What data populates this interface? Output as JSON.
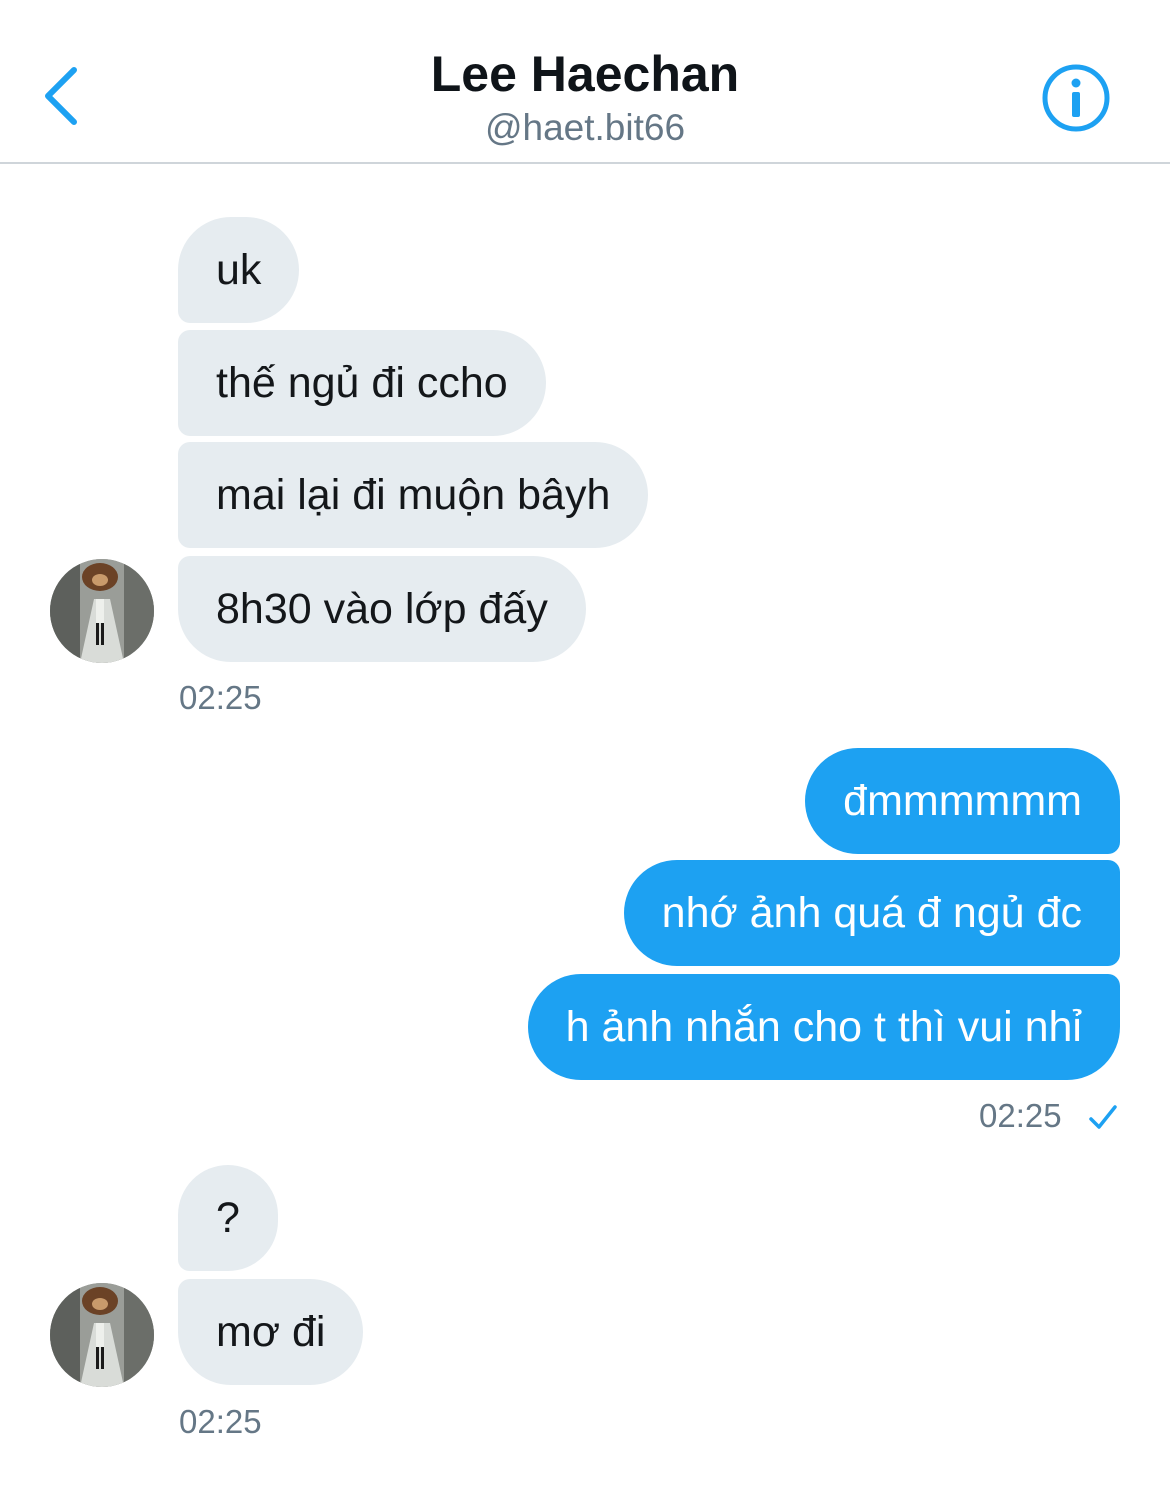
{
  "header": {
    "title": "Lee Haechan",
    "handle": "@haet.bit66"
  },
  "messages": [
    {
      "text": "uk"
    },
    {
      "text": "thế ngủ đi ccho"
    },
    {
      "text": "mai lại đi muộn bâyh"
    },
    {
      "text": "8h30 vào lớp đấy"
    },
    {
      "time": "02:25"
    },
    {
      "text": "đmmmmmm"
    },
    {
      "text": "nhớ ảnh quá đ ngủ đc"
    },
    {
      "text": "h ảnh nhắn cho t thì vui nhỉ"
    },
    {
      "time": "02:25"
    },
    {
      "text": "?"
    },
    {
      "text": "mơ đi"
    },
    {
      "time": "02:25"
    }
  ],
  "colors": {
    "accent": "#1da1f2",
    "incoming_bubble": "#e6ecf0",
    "secondary_text": "#657786"
  },
  "icons": {
    "back": "chevron-left-icon",
    "info": "info-circle-icon",
    "read_receipt": "checkmark-icon"
  }
}
